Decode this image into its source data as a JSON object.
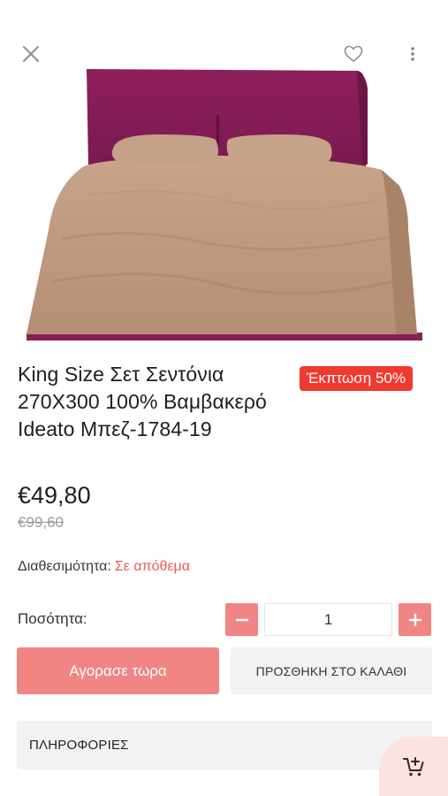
{
  "product": {
    "title": "King Size Σετ Σεντόνια 270X300 100% Βαμβακερό Ideato Μπεζ-1784-19",
    "discount_badge": "Έκπτωση 50%",
    "price": "€49,80",
    "old_price": "€99,60"
  },
  "availability": {
    "label": "Διαθεσιμότητα:",
    "value": "Σε απόθεμα"
  },
  "quantity": {
    "label": "Ποσότητα:",
    "value": "1"
  },
  "actions": {
    "buy_now_label": "Αγορασε τωρα",
    "add_to_cart_label": "ΠΡΟΣΘΗΚΗ ΣΤΟ ΚΑΛΑΘΙ"
  },
  "sections": {
    "info_label": "ΠΛΗΡΟΦΟΡΙΕΣ"
  },
  "icons": {
    "close": "close-icon",
    "favorite": "heart-icon",
    "more": "more-vertical-icon",
    "minus": "minus-icon",
    "plus": "plus-icon",
    "cart": "cart-add-icon"
  },
  "colors": {
    "accent": "#f08584",
    "discount": "#f03a2f",
    "stock": "#ef5a53",
    "secondary_bg": "#f1f2f4"
  }
}
